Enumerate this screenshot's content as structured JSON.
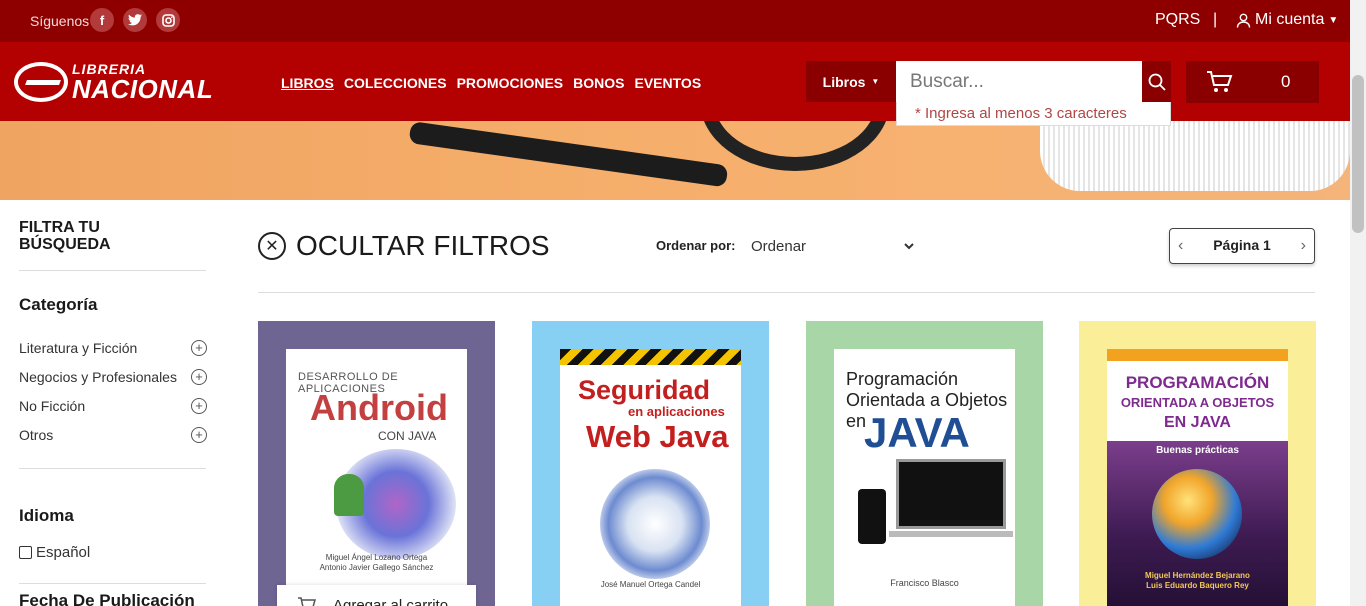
{
  "topbar": {
    "follow_label": "Síguenos",
    "social": [
      {
        "icon": "facebook-icon",
        "glyph": "f"
      },
      {
        "icon": "twitter-icon",
        "glyph": "🐦"
      },
      {
        "icon": "instagram-icon",
        "glyph": "◎"
      }
    ],
    "pqrs": "PQRS",
    "separator": "|",
    "account": "Mi cuenta"
  },
  "header": {
    "logo_line1": "LIBRERIA",
    "logo_line2": "NACIONAL",
    "nav": [
      {
        "label": "LIBROS",
        "active": true
      },
      {
        "label": "COLECCIONES",
        "active": false
      },
      {
        "label": "PROMOCIONES",
        "active": false
      },
      {
        "label": "BONOS",
        "active": false
      },
      {
        "label": "EVENTOS",
        "active": false
      }
    ],
    "search_category": "Libros",
    "search_placeholder": "Buscar...",
    "search_value": "",
    "search_hint": "* Ingresa al menos 3 caracteres",
    "cart_count": "0"
  },
  "sidebar": {
    "title": "FILTRA TU BÚSQUEDA",
    "category_title": "Categoría",
    "categories": [
      "Literatura y Ficción",
      "Negocios y Profesionales",
      "No Ficción",
      "Otros"
    ],
    "language_title": "Idioma",
    "languages": [
      "Español"
    ],
    "date_title": "Fecha De Publicación"
  },
  "main": {
    "hide_filters": "OCULTAR FILTROS",
    "sort_label": "Ordenar por:",
    "sort_value": "Ordenar",
    "page_label": "Página 1",
    "add_to_cart": "Agregar al carrito"
  },
  "products": [
    {
      "bg": "#6e6592",
      "cover_top": "DESARROLLO DE APLICACIONES",
      "cover_title": "Android",
      "cover_sub": "CON JAVA",
      "cover_authors": "Miguel Ángel Lozano Ortega\nAntonio Javier Gallego Sánchez"
    },
    {
      "bg": "#87d0f4",
      "cover_t1": "Seguridad",
      "cover_t2": "en aplicaciones",
      "cover_t3": "Web Java",
      "cover_authors": "José Manuel Ortega Candel"
    },
    {
      "bg": "#a9d6a7",
      "cover_title": "Programación Orientada a Objetos en",
      "cover_java": "JAVA",
      "cover_authors": "Francisco Blasco"
    },
    {
      "bg": "#fbee99",
      "cover_t1": "PROGRAMACIÓN",
      "cover_t2": "ORIENTADA A OBJETOS",
      "cover_t3": "EN JAVA",
      "cover_sub": "Buenas prácticas",
      "cover_authors": "Miguel Hernández Bejarano\nLuis Eduardo Baquero Rey"
    }
  ],
  "colors": {
    "topbar": "#8e0000",
    "header": "#b30000",
    "accent_dark": "#8a0000"
  }
}
